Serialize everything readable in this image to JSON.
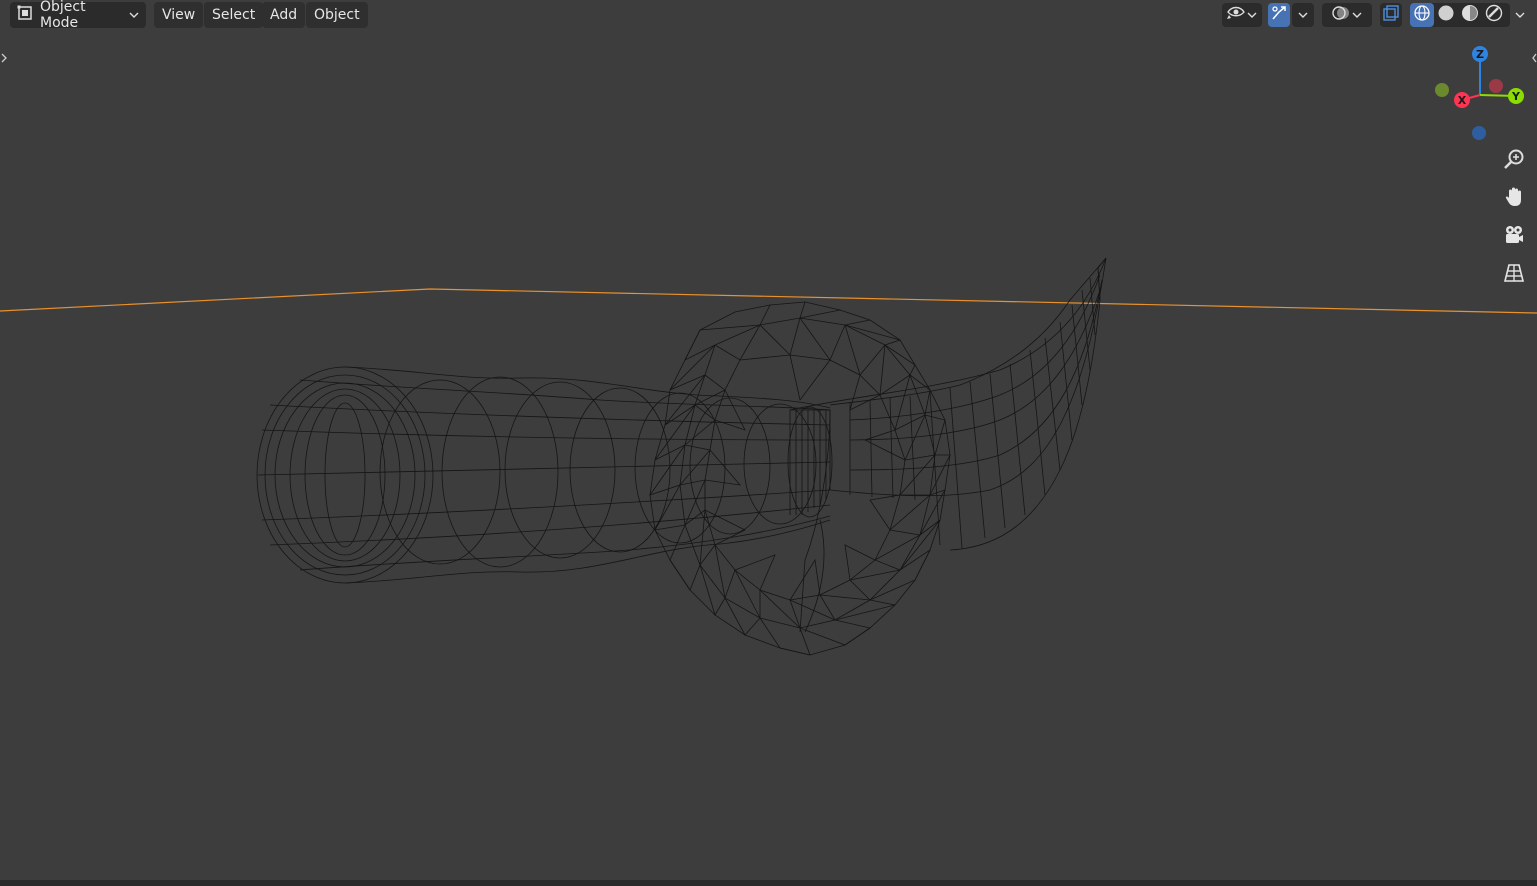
{
  "header": {
    "mode_selector": {
      "label": "Object Mode"
    },
    "menus": [
      {
        "label": "View"
      },
      {
        "label": "Select"
      },
      {
        "label": "Add"
      },
      {
        "label": "Object"
      }
    ],
    "right_icons": [
      "visibility-eye-icon",
      "gizmo-toggle-icon",
      "overlay-icon",
      "xray-toggle-icon",
      "wireframe-shading-icon",
      "solid-shading-icon",
      "material-shading-icon",
      "rendered-shading-icon"
    ],
    "active_shading": "wireframe"
  },
  "gizmo": {
    "axes": [
      {
        "label": "Z",
        "color": "#2f84e3"
      },
      {
        "label": "Y",
        "color": "#8bdc00"
      },
      {
        "label": "X",
        "color": "#ff3352"
      }
    ],
    "negative_axes_colors": [
      "#6b8a2d",
      "#9b3a47",
      "#2f5ea0"
    ]
  },
  "navigation_tools": [
    "zoom-icon",
    "pan-hand-icon",
    "camera-view-icon",
    "perspective-grid-icon"
  ],
  "colors": {
    "background": "#3d3d3d",
    "selection_outline": "#e8912e",
    "wireframe": "#111111",
    "accent": "#4772b3"
  }
}
